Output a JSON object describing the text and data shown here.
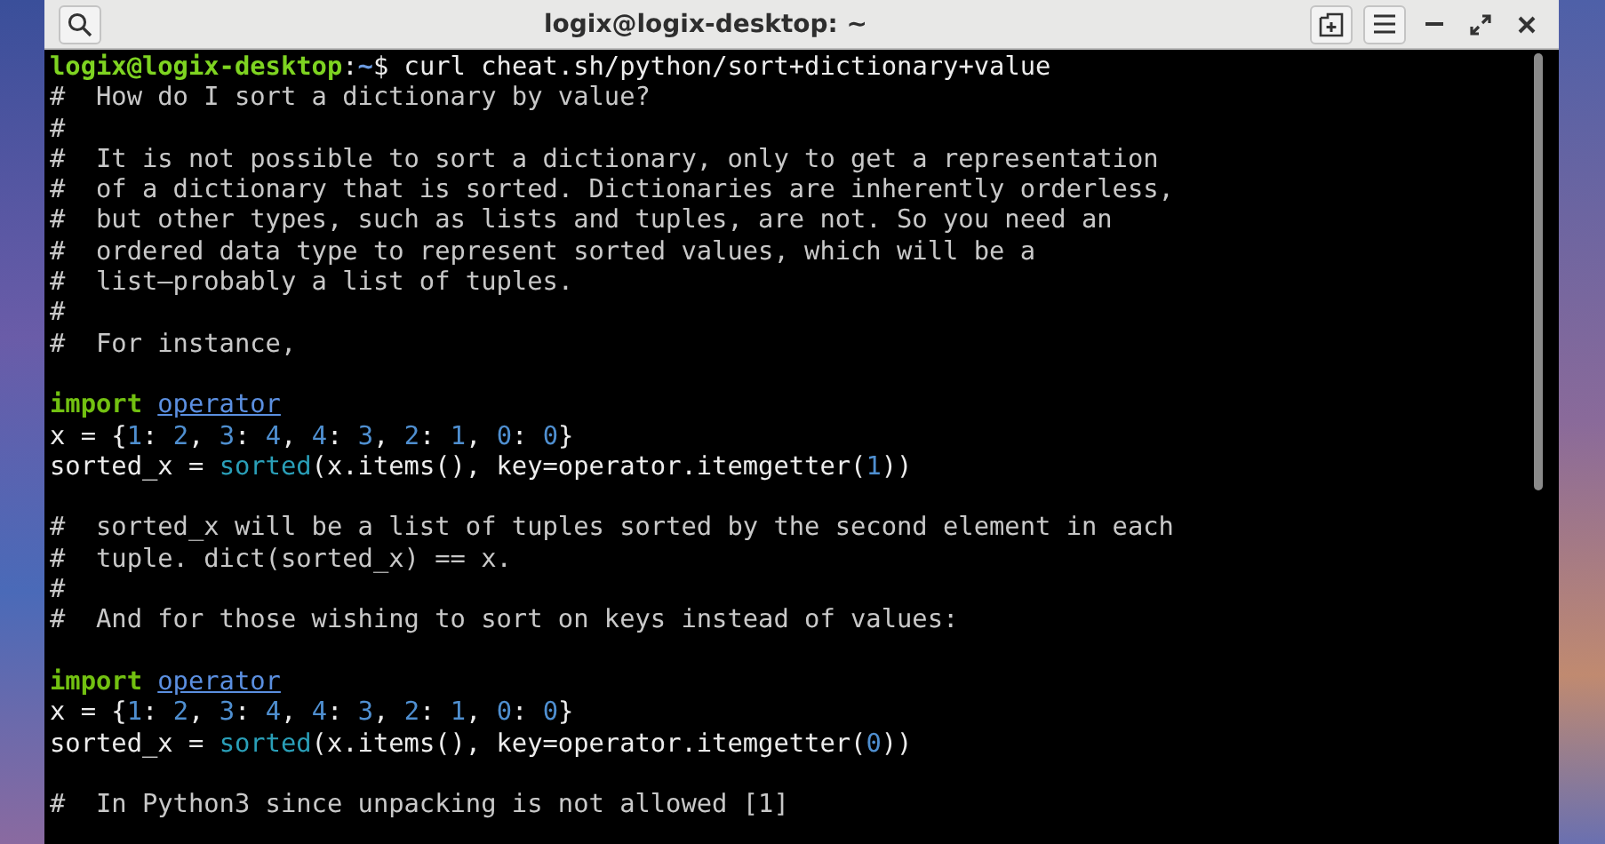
{
  "window": {
    "title": "logix@logix-desktop: ~"
  },
  "terminal": {
    "lines": [
      {
        "segments": [
          {
            "kind": "user",
            "text": "logix@logix-desktop"
          },
          {
            "kind": "plain",
            "text": ":"
          },
          {
            "kind": "path",
            "text": "~"
          },
          {
            "kind": "plain",
            "text": "$ curl cheat.sh/python/sort+dictionary+value"
          }
        ]
      },
      {
        "segments": [
          {
            "kind": "comment",
            "text": "#  How do I sort a dictionary by value?"
          }
        ]
      },
      {
        "segments": [
          {
            "kind": "comment",
            "text": "#"
          }
        ]
      },
      {
        "segments": [
          {
            "kind": "comment",
            "text": "#  It is not possible to sort a dictionary, only to get a representation"
          }
        ]
      },
      {
        "segments": [
          {
            "kind": "comment",
            "text": "#  of a dictionary that is sorted. Dictionaries are inherently orderless,"
          }
        ]
      },
      {
        "segments": [
          {
            "kind": "comment",
            "text": "#  but other types, such as lists and tuples, are not. So you need an"
          }
        ]
      },
      {
        "segments": [
          {
            "kind": "comment",
            "text": "#  ordered data type to represent sorted values, which will be a"
          }
        ]
      },
      {
        "segments": [
          {
            "kind": "comment",
            "text": "#  list—probably a list of tuples."
          }
        ]
      },
      {
        "segments": [
          {
            "kind": "comment",
            "text": "#"
          }
        ]
      },
      {
        "segments": [
          {
            "kind": "comment",
            "text": "#  For instance,"
          }
        ]
      },
      {
        "blank_before": true,
        "segments": [
          {
            "kind": "keyword",
            "text": "import"
          },
          {
            "kind": "module",
            "text": "operator"
          }
        ]
      },
      {
        "segments": [
          {
            "kind": "plain",
            "text": "x = {"
          },
          {
            "kind": "number",
            "text": "1"
          },
          {
            "kind": "plain",
            "text": ": "
          },
          {
            "kind": "number",
            "text": "2"
          },
          {
            "kind": "plain",
            "text": ", "
          },
          {
            "kind": "number",
            "text": "3"
          },
          {
            "kind": "plain",
            "text": ": "
          },
          {
            "kind": "number",
            "text": "4"
          },
          {
            "kind": "plain",
            "text": ", "
          },
          {
            "kind": "number",
            "text": "4"
          },
          {
            "kind": "plain",
            "text": ": "
          },
          {
            "kind": "number",
            "text": "3"
          },
          {
            "kind": "plain",
            "text": ", "
          },
          {
            "kind": "number",
            "text": "2"
          },
          {
            "kind": "plain",
            "text": ": "
          },
          {
            "kind": "number",
            "text": "1"
          },
          {
            "kind": "plain",
            "text": ", "
          },
          {
            "kind": "number",
            "text": "0"
          },
          {
            "kind": "plain",
            "text": ": "
          },
          {
            "kind": "number",
            "text": "0"
          },
          {
            "kind": "plain",
            "text": "}"
          }
        ]
      },
      {
        "segments": [
          {
            "kind": "plain",
            "text": "sorted_x = "
          },
          {
            "kind": "builtin",
            "text": "sorted"
          },
          {
            "kind": "plain",
            "text": "(x.items(), key=operator.itemgetter("
          },
          {
            "kind": "number",
            "text": "1"
          },
          {
            "kind": "plain",
            "text": "))"
          }
        ]
      },
      {
        "blank_before": true,
        "segments": [
          {
            "kind": "comment",
            "text": "#  sorted_x will be a list of tuples sorted by the second element in each"
          }
        ]
      },
      {
        "segments": [
          {
            "kind": "comment",
            "text": "#  tuple. dict(sorted_x) == x."
          }
        ]
      },
      {
        "segments": [
          {
            "kind": "comment",
            "text": "#"
          }
        ]
      },
      {
        "segments": [
          {
            "kind": "comment",
            "text": "#  And for those wishing to sort on keys instead of values:"
          }
        ]
      },
      {
        "blank_before": true,
        "segments": [
          {
            "kind": "keyword",
            "text": "import"
          },
          {
            "kind": "module",
            "text": "operator"
          }
        ]
      },
      {
        "segments": [
          {
            "kind": "plain",
            "text": "x = {"
          },
          {
            "kind": "number",
            "text": "1"
          },
          {
            "kind": "plain",
            "text": ": "
          },
          {
            "kind": "number",
            "text": "2"
          },
          {
            "kind": "plain",
            "text": ", "
          },
          {
            "kind": "number",
            "text": "3"
          },
          {
            "kind": "plain",
            "text": ": "
          },
          {
            "kind": "number",
            "text": "4"
          },
          {
            "kind": "plain",
            "text": ", "
          },
          {
            "kind": "number",
            "text": "4"
          },
          {
            "kind": "plain",
            "text": ": "
          },
          {
            "kind": "number",
            "text": "3"
          },
          {
            "kind": "plain",
            "text": ", "
          },
          {
            "kind": "number",
            "text": "2"
          },
          {
            "kind": "plain",
            "text": ": "
          },
          {
            "kind": "number",
            "text": "1"
          },
          {
            "kind": "plain",
            "text": ", "
          },
          {
            "kind": "number",
            "text": "0"
          },
          {
            "kind": "plain",
            "text": ": "
          },
          {
            "kind": "number",
            "text": "0"
          },
          {
            "kind": "plain",
            "text": "}"
          }
        ]
      },
      {
        "segments": [
          {
            "kind": "plain",
            "text": "sorted_x = "
          },
          {
            "kind": "builtin",
            "text": "sorted"
          },
          {
            "kind": "plain",
            "text": "(x.items(), key=operator.itemgetter("
          },
          {
            "kind": "number",
            "text": "0"
          },
          {
            "kind": "plain",
            "text": "))"
          }
        ]
      },
      {
        "blank_before": true,
        "segments": [
          {
            "kind": "comment",
            "text": "#  In Python3 since unpacking is not allowed [1]"
          }
        ]
      }
    ]
  }
}
